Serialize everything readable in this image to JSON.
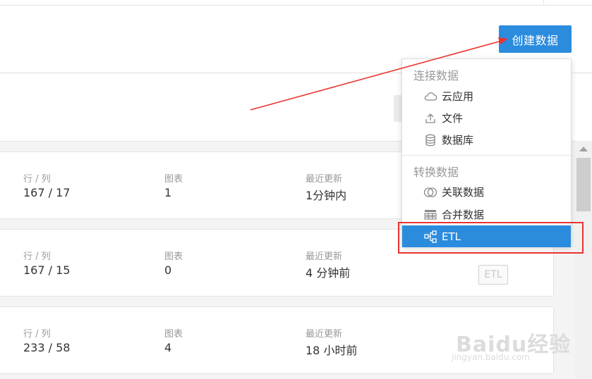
{
  "header": {
    "create_button_label": "创建数据"
  },
  "dropdown": {
    "section_connect": "连接数据",
    "connect_items": [
      {
        "label": "云应用",
        "icon": "cloud-icon"
      },
      {
        "label": "文件",
        "icon": "upload-icon"
      },
      {
        "label": "数据库",
        "icon": "database-icon"
      }
    ],
    "section_transform": "转换数据",
    "transform_items": [
      {
        "label": "关联数据",
        "icon": "join-circles-icon"
      },
      {
        "label": "合并数据",
        "icon": "merge-table-icon"
      },
      {
        "label": "ETL",
        "icon": "etl-flow-icon",
        "selected": true
      }
    ]
  },
  "cards": [
    {
      "rows_cols_label": "行 / 列",
      "rows_cols": "167 / 17",
      "charts_label": "图表",
      "charts": "1",
      "updated_label": "最近更新",
      "updated": "1分钟内"
    },
    {
      "rows_cols_label": "行 / 列",
      "rows_cols": "167 / 15",
      "charts_label": "图表",
      "charts": "0",
      "updated_label": "最近更新",
      "updated": "4 分钟前",
      "type_badge": "ETL"
    },
    {
      "rows_cols_label": "行 / 列",
      "rows_cols": "233 / 58",
      "charts_label": "图表",
      "charts": "4",
      "updated_label": "最近更新",
      "updated": "18 小时前"
    }
  ],
  "watermark": {
    "main": "Baidu经验",
    "url": "jingyan.baidu.com"
  },
  "colors": {
    "accent": "#2b8cde",
    "annotation": "#e8342f"
  }
}
